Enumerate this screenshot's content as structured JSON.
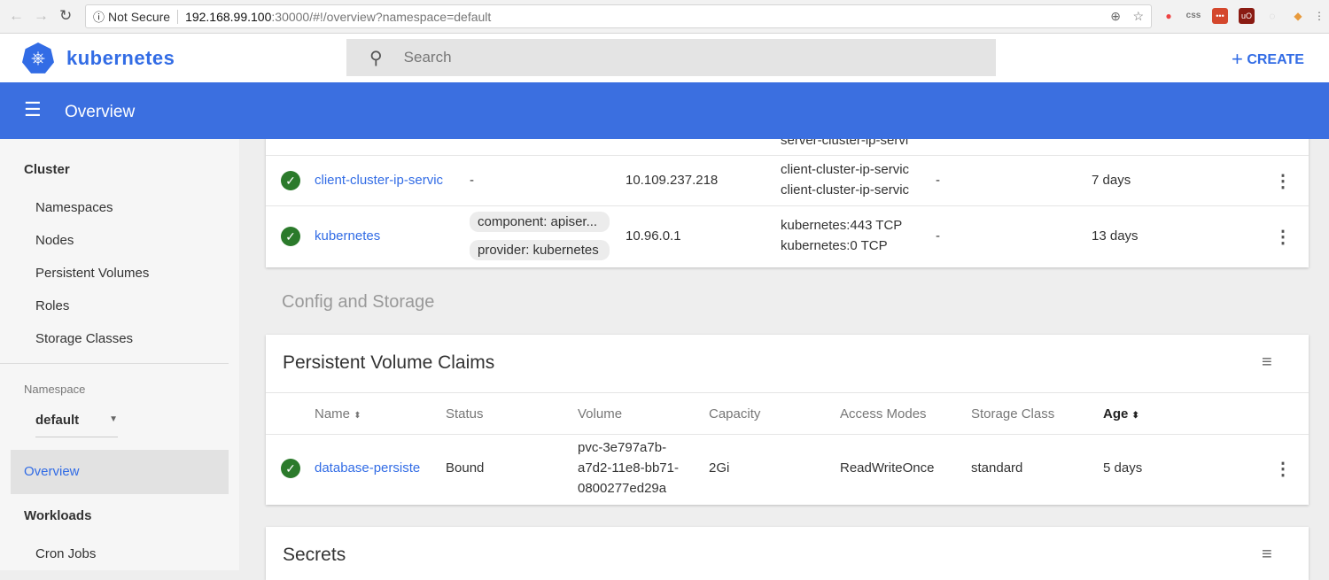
{
  "browser": {
    "security": "Not Secure",
    "url_host": "192.168.99.100",
    "url_path": ":30000/#!/overview?namespace=default",
    "extensions": [
      "opera-icon",
      "css-icon",
      "lastpass-icon",
      "ublock-icon",
      "extension-icon",
      "metamask-icon"
    ]
  },
  "app": {
    "brand": "kubernetes",
    "search_placeholder": "Search",
    "create_label": "CREATE",
    "page_title": "Overview",
    "accent": "#326ce5",
    "header_color": "#3b6fe0"
  },
  "sidebar": {
    "cluster_heading": "Cluster",
    "cluster_items": [
      "Namespaces",
      "Nodes",
      "Persistent Volumes",
      "Roles",
      "Storage Classes"
    ],
    "namespace_label": "Namespace",
    "namespace_value": "default",
    "overview": "Overview",
    "workloads_heading": "Workloads",
    "workload_items": [
      "Cron Jobs"
    ]
  },
  "services": {
    "partial_row_endpoint": "server-cluster-ip-servi",
    "rows": [
      {
        "name": "client-cluster-ip-servic",
        "labels": [
          "-"
        ],
        "cluster_ip": "10.109.237.218",
        "internal_endpoints": [
          "client-cluster-ip-servic",
          "client-cluster-ip-servic"
        ],
        "external_endpoints": "-",
        "age": "7 days",
        "status": "ok"
      },
      {
        "name": "kubernetes",
        "labels": [
          "component: apiser...",
          "provider: kubernetes"
        ],
        "cluster_ip": "10.96.0.1",
        "internal_endpoints": [
          "kubernetes:443 TCP",
          "kubernetes:0 TCP"
        ],
        "external_endpoints": "-",
        "age": "13 days",
        "status": "ok"
      }
    ]
  },
  "config_section": "Config and Storage",
  "pvc": {
    "title": "Persistent Volume Claims",
    "columns": [
      "Name",
      "Status",
      "Volume",
      "Capacity",
      "Access Modes",
      "Storage Class",
      "Age"
    ],
    "rows": [
      {
        "name": "database-persiste",
        "status": "Bound",
        "volume": [
          "pvc-3e797a7b-",
          "a7d2-11e8-bb71-",
          "0800277ed29a"
        ],
        "capacity": "2Gi",
        "access_modes": "ReadWriteOnce",
        "storage_class": "standard",
        "age": "5 days"
      }
    ]
  },
  "secrets": {
    "title": "Secrets"
  }
}
